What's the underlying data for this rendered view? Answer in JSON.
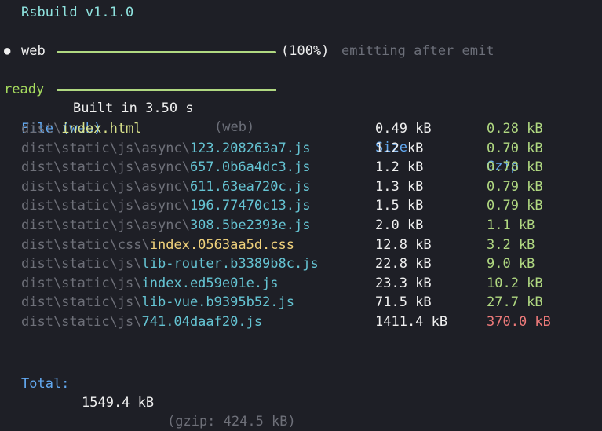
{
  "title": "Rsbuild v1.1.0",
  "progress": {
    "dot": "●",
    "env": "web",
    "fraction": 1.0,
    "percent_text": "(100%)",
    "status": "emitting after emit"
  },
  "ready": {
    "label": "ready",
    "built": "Built in 3.50 s",
    "env": "(web)"
  },
  "table": {
    "headers": {
      "file": "File (web)",
      "size": "Size",
      "gzip": "Gzip"
    },
    "rows": [
      {
        "dir": "dist\\",
        "name": "index.html",
        "kind": "html",
        "size": "0.49 kB",
        "gzip": "0.28 kB",
        "warn": false
      },
      {
        "dir": "dist\\static\\js\\async\\",
        "name": "123.208263a7.js",
        "kind": "js",
        "size": "1.2 kB",
        "gzip": "0.70 kB",
        "warn": false
      },
      {
        "dir": "dist\\static\\js\\async\\",
        "name": "657.0b6a4dc3.js",
        "kind": "js",
        "size": "1.2 kB",
        "gzip": "0.78 kB",
        "warn": false
      },
      {
        "dir": "dist\\static\\js\\async\\",
        "name": "611.63ea720c.js",
        "kind": "js",
        "size": "1.3 kB",
        "gzip": "0.79 kB",
        "warn": false
      },
      {
        "dir": "dist\\static\\js\\async\\",
        "name": "196.77470c13.js",
        "kind": "js",
        "size": "1.5 kB",
        "gzip": "0.79 kB",
        "warn": false
      },
      {
        "dir": "dist\\static\\js\\async\\",
        "name": "308.5be2393e.js",
        "kind": "js",
        "size": "2.0 kB",
        "gzip": "1.1 kB",
        "warn": false
      },
      {
        "dir": "dist\\static\\css\\",
        "name": "index.0563aa5d.css",
        "kind": "css",
        "size": "12.8 kB",
        "gzip": "3.2 kB",
        "warn": false
      },
      {
        "dir": "dist\\static\\js\\",
        "name": "lib-router.b3389b8c.js",
        "kind": "js",
        "size": "22.8 kB",
        "gzip": "9.0 kB",
        "warn": false
      },
      {
        "dir": "dist\\static\\js\\",
        "name": "index.ed59e01e.js",
        "kind": "js",
        "size": "23.3 kB",
        "gzip": "10.2 kB",
        "warn": false
      },
      {
        "dir": "dist\\static\\js\\",
        "name": "lib-vue.b9395b52.js",
        "kind": "js",
        "size": "71.5 kB",
        "gzip": "27.7 kB",
        "warn": false
      },
      {
        "dir": "dist\\static\\js\\",
        "name": "741.04daaf20.js",
        "kind": "js",
        "size": "1411.4 kB",
        "gzip": "370.0 kB",
        "warn": true
      }
    ]
  },
  "total": {
    "label": "Total:",
    "value": "1549.4 kB",
    "gzip": "(gzip: 424.5 kB)"
  },
  "colors": {
    "background": "#1e1f26",
    "accent_blue": "#62a8f0",
    "ok_green": "#b0d881",
    "warn_red": "#ee7a7a"
  }
}
